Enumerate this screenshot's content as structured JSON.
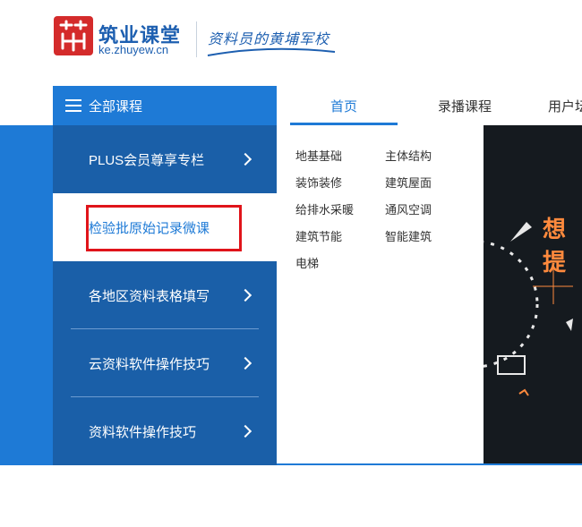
{
  "header": {
    "logo_title": "筑业课堂",
    "logo_url": "ke.zhuyew.cn",
    "slogan": "资料员的黄埔军校"
  },
  "nav": {
    "all_courses": "全部课程",
    "tabs": [
      {
        "label": "首页",
        "active": true
      },
      {
        "label": "录播课程",
        "active": false
      },
      {
        "label": "用户坛",
        "active": false
      }
    ]
  },
  "sidebar": {
    "items": [
      {
        "label": "PLUS会员尊享专栏",
        "has_arrow": true
      },
      {
        "label": "检验批原始记录微课",
        "has_arrow": false,
        "hovered": true
      },
      {
        "label": "各地区资料表格填写",
        "has_arrow": true
      },
      {
        "label": "云资料软件操作技巧",
        "has_arrow": true
      },
      {
        "label": "资料软件操作技巧",
        "has_arrow": true
      }
    ]
  },
  "submenu": {
    "links": [
      "地基基础",
      "主体结构",
      "装饰装修",
      "建筑屋面",
      "给排水采暖",
      "通风空调",
      "建筑节能",
      "智能建筑",
      "电梯"
    ]
  },
  "banner": {
    "headline": "想提"
  },
  "colors": {
    "primary": "#1e7ad6",
    "sidebar": "#1a5fa8",
    "highlight": "#e0141a",
    "logo_red": "#d42b2b"
  }
}
